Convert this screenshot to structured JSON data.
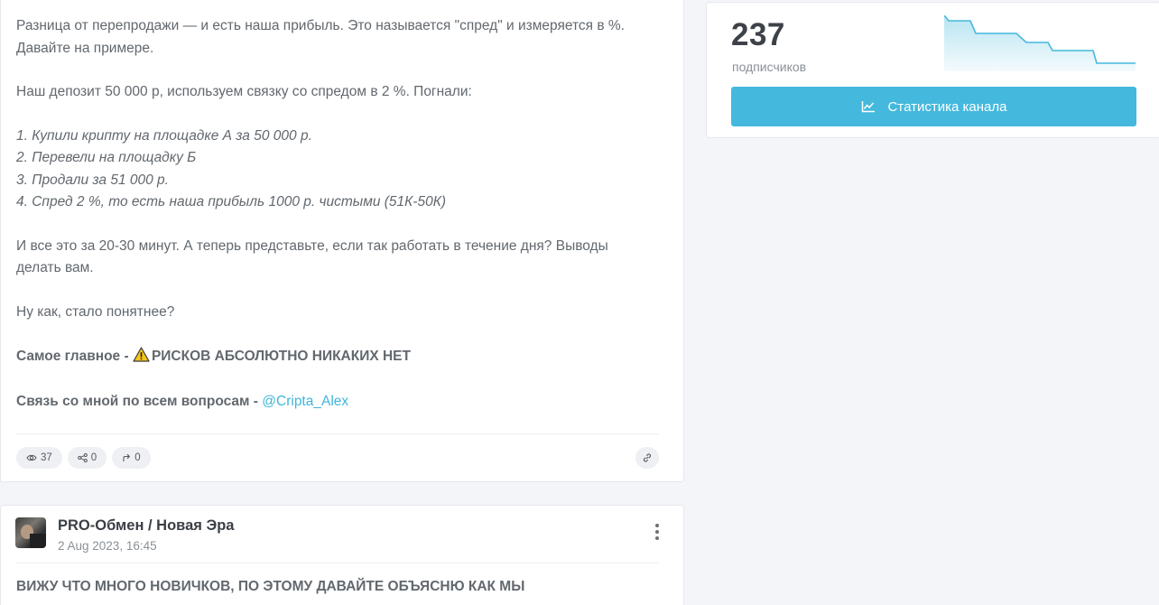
{
  "post1": {
    "lines": [
      "Разница от перепродажи — и есть наша прибыль. Это называется \"спред\" и измеряется в %.",
      "Давайте на примере.",
      "Наш депозит 50 000 р, используем связку со спредом в 2 %. Погнали:",
      "1. Купили крипту на площадке А за 50 000 р.",
      "2. Перевели на площадку Б",
      "3. Продали за 51 000 р.",
      "4. Спред 2 %, то есть наша прибыль 1000 р. чистыми (51К-50К)",
      "И все это за 20-30 минут. А теперь представьте, если так работать в течение дня? Выводы",
      "делать вам.",
      "Ну как, стало понятнее?"
    ],
    "important_label": "Самое главное - ",
    "important_text": "РИСКОВ АБСОЛЮТНО НИКАКИХ НЕТ",
    "contact_label": "Связь со мной по всем вопросам - ",
    "contact_handle": "@Cripta_Alex",
    "views": "37",
    "shares": "0",
    "forwards": "0"
  },
  "post2": {
    "channel_name": "PRO-Обмен / Новая Эра",
    "date": "2 Aug 2023, 16:45",
    "text": "ВИЖУ ЧТО МНОГО НОВИЧКОВ, ПО ЭТОМУ ДАВАЙТЕ ОБЪЯСНЮ КАК МЫ"
  },
  "channel_card": {
    "subscribers": "237",
    "subscribers_label": "подписчиков",
    "stats_button": "Статистика канала",
    "sparkline_color": "#44b9dd"
  },
  "icons": {
    "views": "eye-icon",
    "shares": "share-icon",
    "forwards": "forward-icon",
    "link": "link-icon",
    "warning": "warning-icon",
    "stats": "chart-line-icon",
    "menu": "more-vertical-icon"
  }
}
